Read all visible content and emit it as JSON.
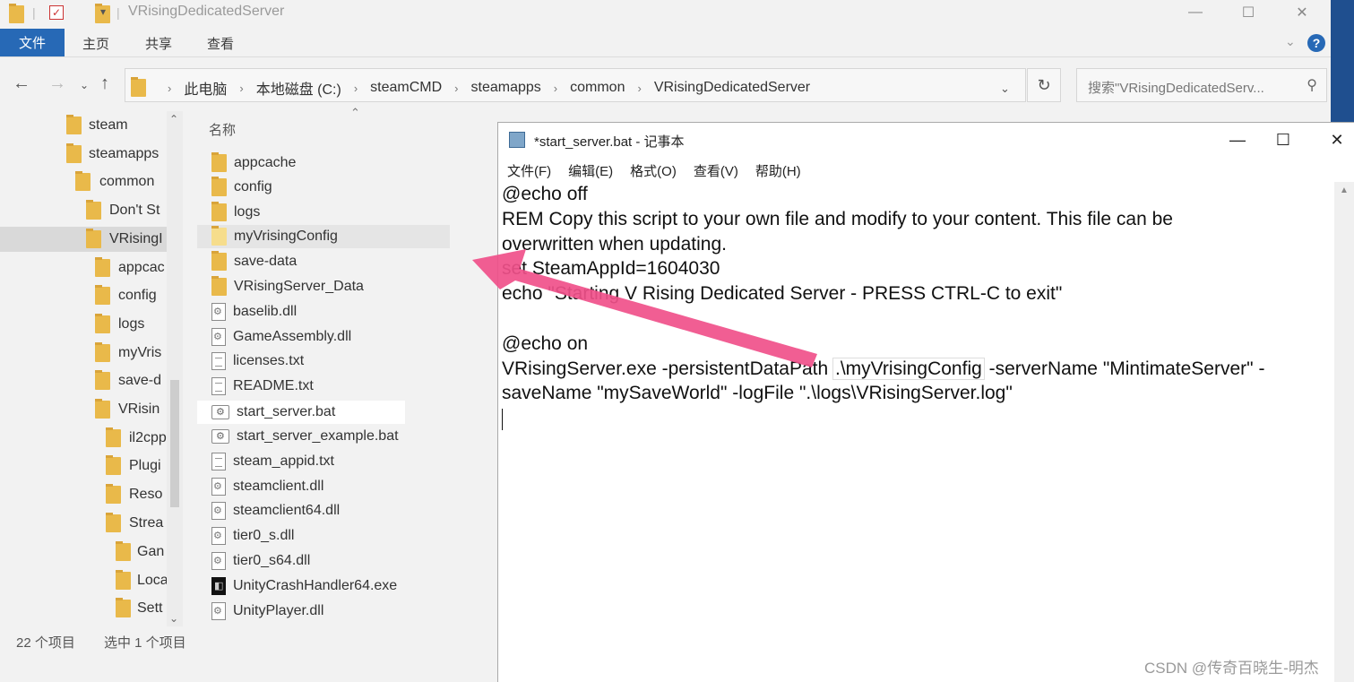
{
  "explorer": {
    "title": "VRisingDedicatedServer",
    "ribbon_tabs": {
      "file": "文件",
      "home": "主页",
      "share": "共享",
      "view": "查看"
    },
    "breadcrumb": [
      "此电脑",
      "本地磁盘 (C:)",
      "steamCMD",
      "steamapps",
      "common",
      "VRisingDedicatedServer"
    ],
    "search_placeholder": "搜索\"VRisingDedicatedServ...",
    "nav_items": [
      "steam",
      "steamapps",
      "common",
      "Don't St",
      "VRisingI",
      "appcac",
      "config",
      "logs",
      "myVris",
      "save-d",
      "VRisin",
      "il2cpp",
      "Plugi",
      "Reso",
      "Strea",
      "Gan",
      "Loca",
      "Sett"
    ],
    "column_name": "名称",
    "files": [
      {
        "name": "appcache",
        "type": "folder"
      },
      {
        "name": "config",
        "type": "folder"
      },
      {
        "name": "logs",
        "type": "folder"
      },
      {
        "name": "myVrisingConfig",
        "type": "folder"
      },
      {
        "name": "save-data",
        "type": "folder"
      },
      {
        "name": "VRisingServer_Data",
        "type": "folder"
      },
      {
        "name": "baselib.dll",
        "type": "dll"
      },
      {
        "name": "GameAssembly.dll",
        "type": "dll"
      },
      {
        "name": "licenses.txt",
        "type": "txt"
      },
      {
        "name": "README.txt",
        "type": "txt"
      },
      {
        "name": "start_server.bat",
        "type": "bat"
      },
      {
        "name": "start_server_example.bat",
        "type": "bat"
      },
      {
        "name": "steam_appid.txt",
        "type": "txt"
      },
      {
        "name": "steamclient.dll",
        "type": "dll"
      },
      {
        "name": "steamclient64.dll",
        "type": "dll"
      },
      {
        "name": "tier0_s.dll",
        "type": "dll"
      },
      {
        "name": "tier0_s64.dll",
        "type": "dll"
      },
      {
        "name": "UnityCrashHandler64.exe",
        "type": "exe"
      },
      {
        "name": "UnityPlayer.dll",
        "type": "dll"
      }
    ],
    "status_count": "22 个项目",
    "status_selected": "选中 1 个项目"
  },
  "notepad": {
    "title": "*start_server.bat - 记事本",
    "menu": [
      "文件(F)",
      "编辑(E)",
      "格式(O)",
      "查看(V)",
      "帮助(H)"
    ],
    "lines": {
      "l1": "@echo off",
      "l2": "REM Copy this script to your own file and modify to your content. This file can be",
      "l3": "overwritten when updating.",
      "l4": "set SteamAppId=1604030",
      "l5": "echo \"Starting V Rising Dedicated Server - PRESS CTRL-C to exit\"",
      "l6": "",
      "l7": "@echo on",
      "l8a": "VRisingServer.exe -persistentDataPath ",
      "l8b": ".\\myVrisingConfig",
      "l8c": " -serverName \"MintimateServer\" -",
      "l9": "saveName \"mySaveWorld\" -logFile \".\\logs\\VRisingServer.log\""
    }
  },
  "watermark": "CSDN @传奇百晓生-明杰",
  "colors": {
    "accent": "#2769b6",
    "arrow": "#f0508a",
    "folder": "#e9b94a"
  }
}
